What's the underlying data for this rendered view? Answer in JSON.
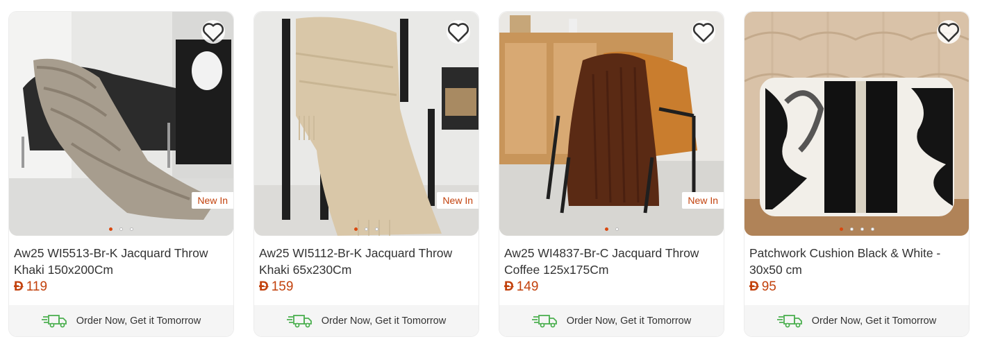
{
  "products": [
    {
      "title": "Aw25 WI5513-Br-K Jacquard Throw Khaki 150x200Cm",
      "currency": "Đ",
      "price": "119",
      "badge": "New In",
      "dots": 3,
      "active_dot": 0
    },
    {
      "title": "Aw25 WI5112-Br-K Jacquard Throw Khaki 65x230Cm",
      "currency": "Đ",
      "price": "159",
      "badge": "New In",
      "dots": 3,
      "active_dot": 0
    },
    {
      "title": "Aw25 WI4837-Br-C Jacquard Throw Coffee 125x175Cm",
      "currency": "Đ",
      "price": "149",
      "badge": "New In",
      "dots": 2,
      "active_dot": 0
    },
    {
      "title": "Patchwork Cushion Black & White - 30x50 cm",
      "currency": "Đ",
      "price": "95",
      "badge": "",
      "dots": 4,
      "active_dot": 0
    }
  ],
  "shipping_text": "Order Now, Get it Tomorrow",
  "colors": {
    "accent": "#c2410c",
    "shipping_icon": "#4caf50"
  },
  "icons": {
    "wishlist": "heart-icon",
    "shipping": "delivery-truck-icon"
  }
}
